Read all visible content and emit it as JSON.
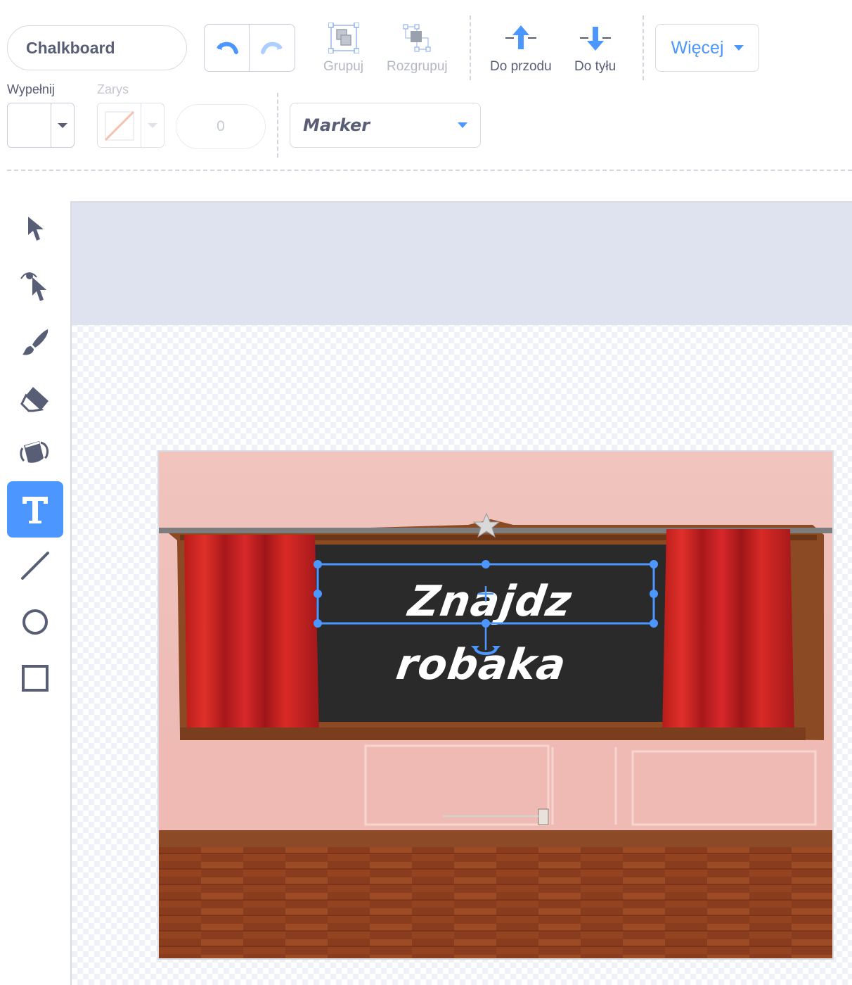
{
  "costume": {
    "name": "Chalkboard"
  },
  "toolbar": {
    "undo_icon": "undo-icon",
    "redo_icon": "redo-icon",
    "group_label": "Grupuj",
    "ungroup_label": "Rozgrupuj",
    "forward_label": "Do przodu",
    "backward_label": "Do tyłu",
    "more_label": "Więcej"
  },
  "fill": {
    "label": "Wypełnij",
    "color": "#ffffff"
  },
  "outline": {
    "label": "Zarys",
    "color": "none"
  },
  "stroke_width": {
    "value": "0"
  },
  "font": {
    "value": "Marker"
  },
  "tools": [
    {
      "name": "select",
      "icon": "arrow-pointer-icon",
      "active": false
    },
    {
      "name": "reshape",
      "icon": "reshape-icon",
      "active": false
    },
    {
      "name": "brush",
      "icon": "brush-icon",
      "active": false
    },
    {
      "name": "eraser",
      "icon": "eraser-icon",
      "active": false
    },
    {
      "name": "fill",
      "icon": "paint-bucket-icon",
      "active": false
    },
    {
      "name": "text",
      "icon": "text-icon",
      "active": true
    },
    {
      "name": "line",
      "icon": "line-icon",
      "active": false
    },
    {
      "name": "circle",
      "icon": "circle-icon",
      "active": false
    },
    {
      "name": "rectangle",
      "icon": "rectangle-icon",
      "active": false
    }
  ],
  "canvas": {
    "text_object": "Znajdz robaka",
    "selection_color": "#4c97ff"
  },
  "colors": {
    "accent": "#4c97ff",
    "text": "#575e75"
  }
}
